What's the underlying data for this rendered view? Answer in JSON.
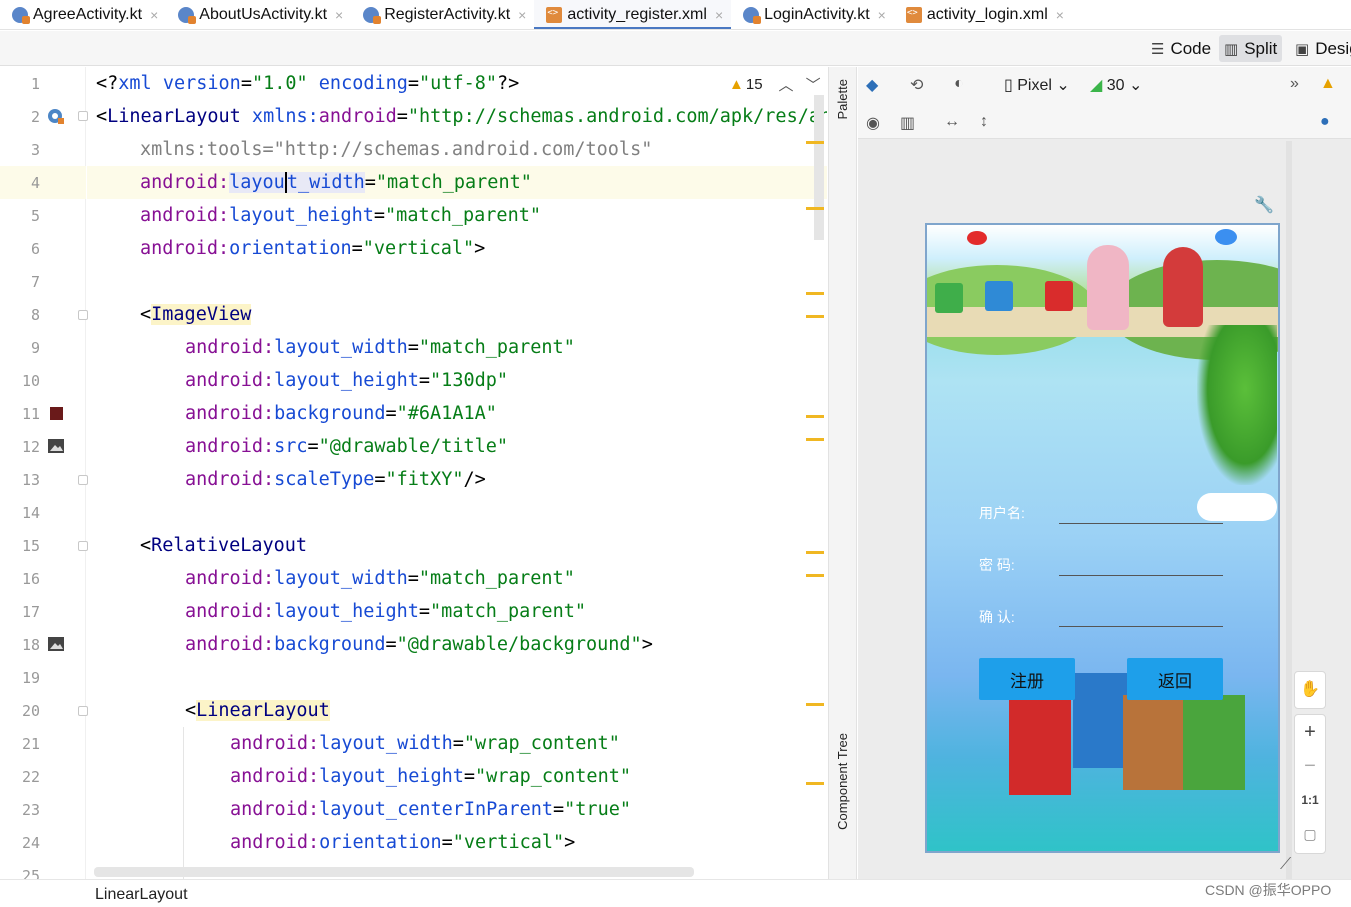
{
  "tabs": [
    {
      "label": "AgreeActivity.kt",
      "kind": "kt"
    },
    {
      "label": "AboutUsActivity.kt",
      "kind": "kt"
    },
    {
      "label": "RegisterActivity.kt",
      "kind": "kt"
    },
    {
      "label": "activity_register.xml",
      "kind": "xml",
      "active": true
    },
    {
      "label": "LoginActivity.kt",
      "kind": "kt"
    },
    {
      "label": "activity_login.xml",
      "kind": "xml"
    }
  ],
  "modes": {
    "code": "Code",
    "split": "Split",
    "design": "Desig"
  },
  "editor": {
    "warnings": "15",
    "lines": [
      "1",
      "2",
      "3",
      "4",
      "5",
      "6",
      "7",
      "8",
      "9",
      "10",
      "11",
      "12",
      "13",
      "14",
      "15",
      "16",
      "17",
      "18",
      "19",
      "20",
      "21",
      "22",
      "23",
      "24",
      "25"
    ]
  },
  "code": {
    "l1": {
      "a": "<?",
      "b": "xml version",
      "c": "=",
      "d": "\"1.0\"",
      "e": " encoding",
      "f": "=",
      "g": "\"utf-8\"",
      "h": "?>"
    },
    "l2": {
      "a": "<",
      "b": "LinearLayout",
      "c": " xmlns:",
      "d": "android",
      "e": "=",
      "f": "\"http://schemas.android.com/apk/res/an"
    },
    "l3": {
      "a": "xmlns:tools=\"http://schemas.android.com/tools\""
    },
    "l4": {
      "a": "android:",
      "b": "layou",
      "c": "t_width",
      "d": "=",
      "e": "\"match_parent\""
    },
    "l5": {
      "a": "android:",
      "b": "layout_height",
      "c": "=",
      "d": "\"match_parent\""
    },
    "l6": {
      "a": "android:",
      "b": "orientation",
      "c": "=",
      "d": "\"vertical\"",
      "e": ">"
    },
    "l8": {
      "a": "<",
      "b": "ImageView"
    },
    "l9": {
      "a": "android:",
      "b": "layout_width",
      "c": "=",
      "d": "\"match_parent\""
    },
    "l10": {
      "a": "android:",
      "b": "layout_height",
      "c": "=",
      "d": "\"130dp\""
    },
    "l11": {
      "a": "android:",
      "b": "background",
      "c": "=",
      "d": "\"#6A1A1A\""
    },
    "l12": {
      "a": "android:",
      "b": "src",
      "c": "=",
      "d": "\"@drawable/title\""
    },
    "l13": {
      "a": "android:",
      "b": "scaleType",
      "c": "=",
      "d": "\"fitXY\"",
      "e": "/>"
    },
    "l15": {
      "a": "<",
      "b": "RelativeLayout"
    },
    "l16": {
      "a": "android:",
      "b": "layout_width",
      "c": "=",
      "d": "\"match_parent\""
    },
    "l17": {
      "a": "android:",
      "b": "layout_height",
      "c": "=",
      "d": "\"match_parent\""
    },
    "l18": {
      "a": "android:",
      "b": "background",
      "c": "=",
      "d": "\"@drawable/background\"",
      "e": ">"
    },
    "l20": {
      "a": "<",
      "b": "LinearLayout"
    },
    "l21": {
      "a": "android:",
      "b": "layout_width",
      "c": "=",
      "d": "\"wrap_content\""
    },
    "l22": {
      "a": "android:",
      "b": "layout_height",
      "c": "=",
      "d": "\"wrap_content\""
    },
    "l23": {
      "a": "android:",
      "b": "layout_centerInParent",
      "c": "=",
      "d": "\"true\""
    },
    "l24": {
      "a": "android:",
      "b": "orientation",
      "c": "=",
      "d": "\"vertical\"",
      "e": ">"
    }
  },
  "colors": {
    "swatch": "#6A1A1A",
    "accent": "#4a78c2"
  },
  "side": {
    "palette": "Palette",
    "tree": "Component Tree"
  },
  "design": {
    "device": "Pixel",
    "api": "30"
  },
  "preview": {
    "username_label": "用户名:",
    "password_label": "密  码:",
    "confirm_label": "确  认:",
    "register_btn": "注册",
    "back_btn": "返回"
  },
  "status": {
    "breadcrumb": "LinearLayout"
  },
  "watermark": "CSDN @振华OPPO"
}
